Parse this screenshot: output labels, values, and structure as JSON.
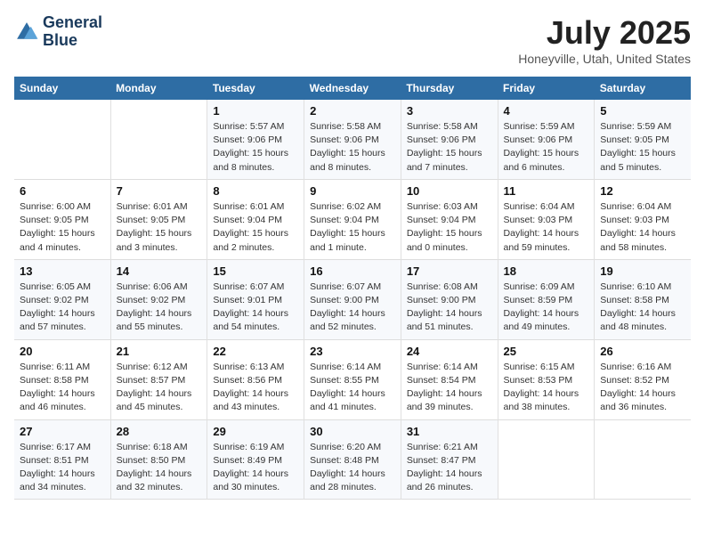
{
  "header": {
    "logo_line1": "General",
    "logo_line2": "Blue",
    "month": "July 2025",
    "location": "Honeyville, Utah, United States"
  },
  "weekdays": [
    "Sunday",
    "Monday",
    "Tuesday",
    "Wednesday",
    "Thursday",
    "Friday",
    "Saturday"
  ],
  "weeks": [
    [
      {
        "day": "",
        "info": ""
      },
      {
        "day": "",
        "info": ""
      },
      {
        "day": "1",
        "info": "Sunrise: 5:57 AM\nSunset: 9:06 PM\nDaylight: 15 hours\nand 8 minutes."
      },
      {
        "day": "2",
        "info": "Sunrise: 5:58 AM\nSunset: 9:06 PM\nDaylight: 15 hours\nand 8 minutes."
      },
      {
        "day": "3",
        "info": "Sunrise: 5:58 AM\nSunset: 9:06 PM\nDaylight: 15 hours\nand 7 minutes."
      },
      {
        "day": "4",
        "info": "Sunrise: 5:59 AM\nSunset: 9:06 PM\nDaylight: 15 hours\nand 6 minutes."
      },
      {
        "day": "5",
        "info": "Sunrise: 5:59 AM\nSunset: 9:05 PM\nDaylight: 15 hours\nand 5 minutes."
      }
    ],
    [
      {
        "day": "6",
        "info": "Sunrise: 6:00 AM\nSunset: 9:05 PM\nDaylight: 15 hours\nand 4 minutes."
      },
      {
        "day": "7",
        "info": "Sunrise: 6:01 AM\nSunset: 9:05 PM\nDaylight: 15 hours\nand 3 minutes."
      },
      {
        "day": "8",
        "info": "Sunrise: 6:01 AM\nSunset: 9:04 PM\nDaylight: 15 hours\nand 2 minutes."
      },
      {
        "day": "9",
        "info": "Sunrise: 6:02 AM\nSunset: 9:04 PM\nDaylight: 15 hours\nand 1 minute."
      },
      {
        "day": "10",
        "info": "Sunrise: 6:03 AM\nSunset: 9:04 PM\nDaylight: 15 hours\nand 0 minutes."
      },
      {
        "day": "11",
        "info": "Sunrise: 6:04 AM\nSunset: 9:03 PM\nDaylight: 14 hours\nand 59 minutes."
      },
      {
        "day": "12",
        "info": "Sunrise: 6:04 AM\nSunset: 9:03 PM\nDaylight: 14 hours\nand 58 minutes."
      }
    ],
    [
      {
        "day": "13",
        "info": "Sunrise: 6:05 AM\nSunset: 9:02 PM\nDaylight: 14 hours\nand 57 minutes."
      },
      {
        "day": "14",
        "info": "Sunrise: 6:06 AM\nSunset: 9:02 PM\nDaylight: 14 hours\nand 55 minutes."
      },
      {
        "day": "15",
        "info": "Sunrise: 6:07 AM\nSunset: 9:01 PM\nDaylight: 14 hours\nand 54 minutes."
      },
      {
        "day": "16",
        "info": "Sunrise: 6:07 AM\nSunset: 9:00 PM\nDaylight: 14 hours\nand 52 minutes."
      },
      {
        "day": "17",
        "info": "Sunrise: 6:08 AM\nSunset: 9:00 PM\nDaylight: 14 hours\nand 51 minutes."
      },
      {
        "day": "18",
        "info": "Sunrise: 6:09 AM\nSunset: 8:59 PM\nDaylight: 14 hours\nand 49 minutes."
      },
      {
        "day": "19",
        "info": "Sunrise: 6:10 AM\nSunset: 8:58 PM\nDaylight: 14 hours\nand 48 minutes."
      }
    ],
    [
      {
        "day": "20",
        "info": "Sunrise: 6:11 AM\nSunset: 8:58 PM\nDaylight: 14 hours\nand 46 minutes."
      },
      {
        "day": "21",
        "info": "Sunrise: 6:12 AM\nSunset: 8:57 PM\nDaylight: 14 hours\nand 45 minutes."
      },
      {
        "day": "22",
        "info": "Sunrise: 6:13 AM\nSunset: 8:56 PM\nDaylight: 14 hours\nand 43 minutes."
      },
      {
        "day": "23",
        "info": "Sunrise: 6:14 AM\nSunset: 8:55 PM\nDaylight: 14 hours\nand 41 minutes."
      },
      {
        "day": "24",
        "info": "Sunrise: 6:14 AM\nSunset: 8:54 PM\nDaylight: 14 hours\nand 39 minutes."
      },
      {
        "day": "25",
        "info": "Sunrise: 6:15 AM\nSunset: 8:53 PM\nDaylight: 14 hours\nand 38 minutes."
      },
      {
        "day": "26",
        "info": "Sunrise: 6:16 AM\nSunset: 8:52 PM\nDaylight: 14 hours\nand 36 minutes."
      }
    ],
    [
      {
        "day": "27",
        "info": "Sunrise: 6:17 AM\nSunset: 8:51 PM\nDaylight: 14 hours\nand 34 minutes."
      },
      {
        "day": "28",
        "info": "Sunrise: 6:18 AM\nSunset: 8:50 PM\nDaylight: 14 hours\nand 32 minutes."
      },
      {
        "day": "29",
        "info": "Sunrise: 6:19 AM\nSunset: 8:49 PM\nDaylight: 14 hours\nand 30 minutes."
      },
      {
        "day": "30",
        "info": "Sunrise: 6:20 AM\nSunset: 8:48 PM\nDaylight: 14 hours\nand 28 minutes."
      },
      {
        "day": "31",
        "info": "Sunrise: 6:21 AM\nSunset: 8:47 PM\nDaylight: 14 hours\nand 26 minutes."
      },
      {
        "day": "",
        "info": ""
      },
      {
        "day": "",
        "info": ""
      }
    ]
  ]
}
